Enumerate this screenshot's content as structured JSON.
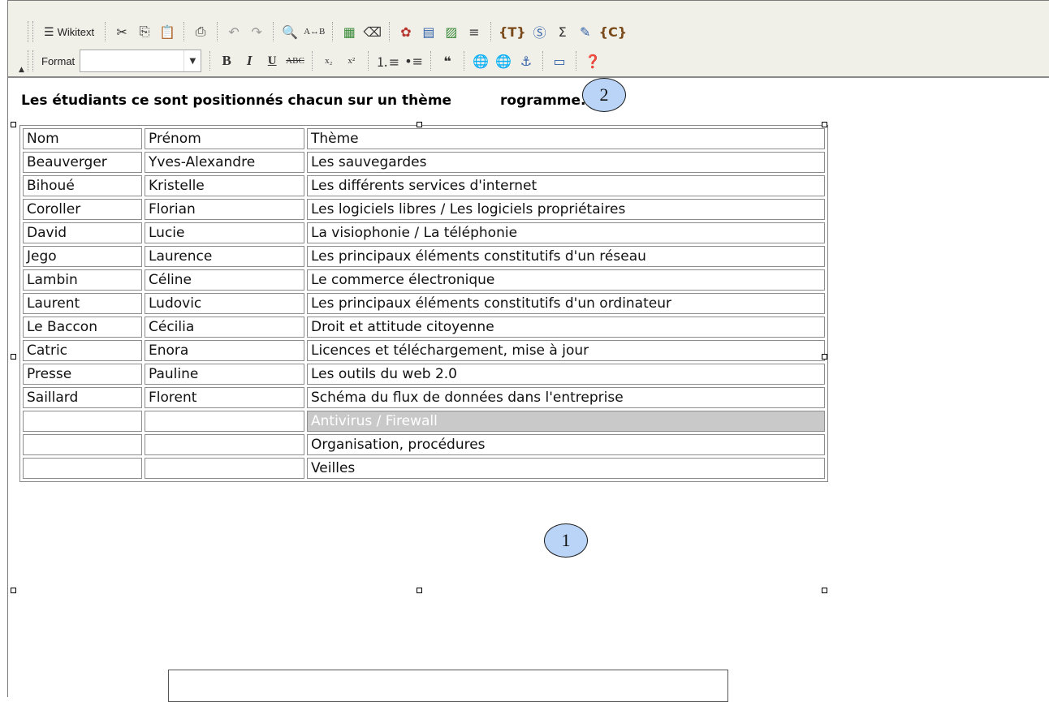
{
  "toolbar": {
    "wikitext_label": "Wikitext",
    "format_label": "Format",
    "format_value": ""
  },
  "heading": "Les étudiants ce sont positionnés chacun sur un thème du programme.",
  "heading_visible_left": "Les étudiants ce sont positionnés chacun sur un thème",
  "heading_visible_right": "rogramme.",
  "table": {
    "header": [
      "Nom",
      "Prénom",
      "Thème"
    ],
    "rows": [
      [
        "Beauverger",
        "Yves-Alexandre",
        "Les sauvegardes"
      ],
      [
        "Bihoué",
        "Kristelle",
        "Les différents services d'internet"
      ],
      [
        "Coroller",
        "Florian",
        "Les logiciels libres / Les logiciels propriétaires"
      ],
      [
        "David",
        "Lucie",
        "La visiophonie / La téléphonie"
      ],
      [
        "Jego",
        "Laurence",
        "Les principaux éléments constitutifs d'un réseau"
      ],
      [
        "Lambin",
        "Céline",
        "Le commerce électronique"
      ],
      [
        "Laurent",
        "Ludovic",
        "Les principaux éléments constitutifs d'un ordinateur"
      ],
      [
        "Le Baccon",
        "Cécilia",
        "Droit et attitude citoyenne"
      ],
      [
        "Catric",
        "Enora",
        "Licences et téléchargement, mise à jour"
      ],
      [
        "Presse",
        "Pauline",
        "Les outils du web 2.0"
      ],
      [
        "Saillard",
        "Florent",
        "Schéma du flux de données dans l'entreprise"
      ],
      [
        "",
        "",
        "Antivirus / Firewall"
      ],
      [
        "",
        "",
        "Organisation, procédures"
      ],
      [
        "",
        "",
        "Veilles"
      ]
    ],
    "selected_row_index": 11
  },
  "callouts": [
    "1",
    "2"
  ]
}
